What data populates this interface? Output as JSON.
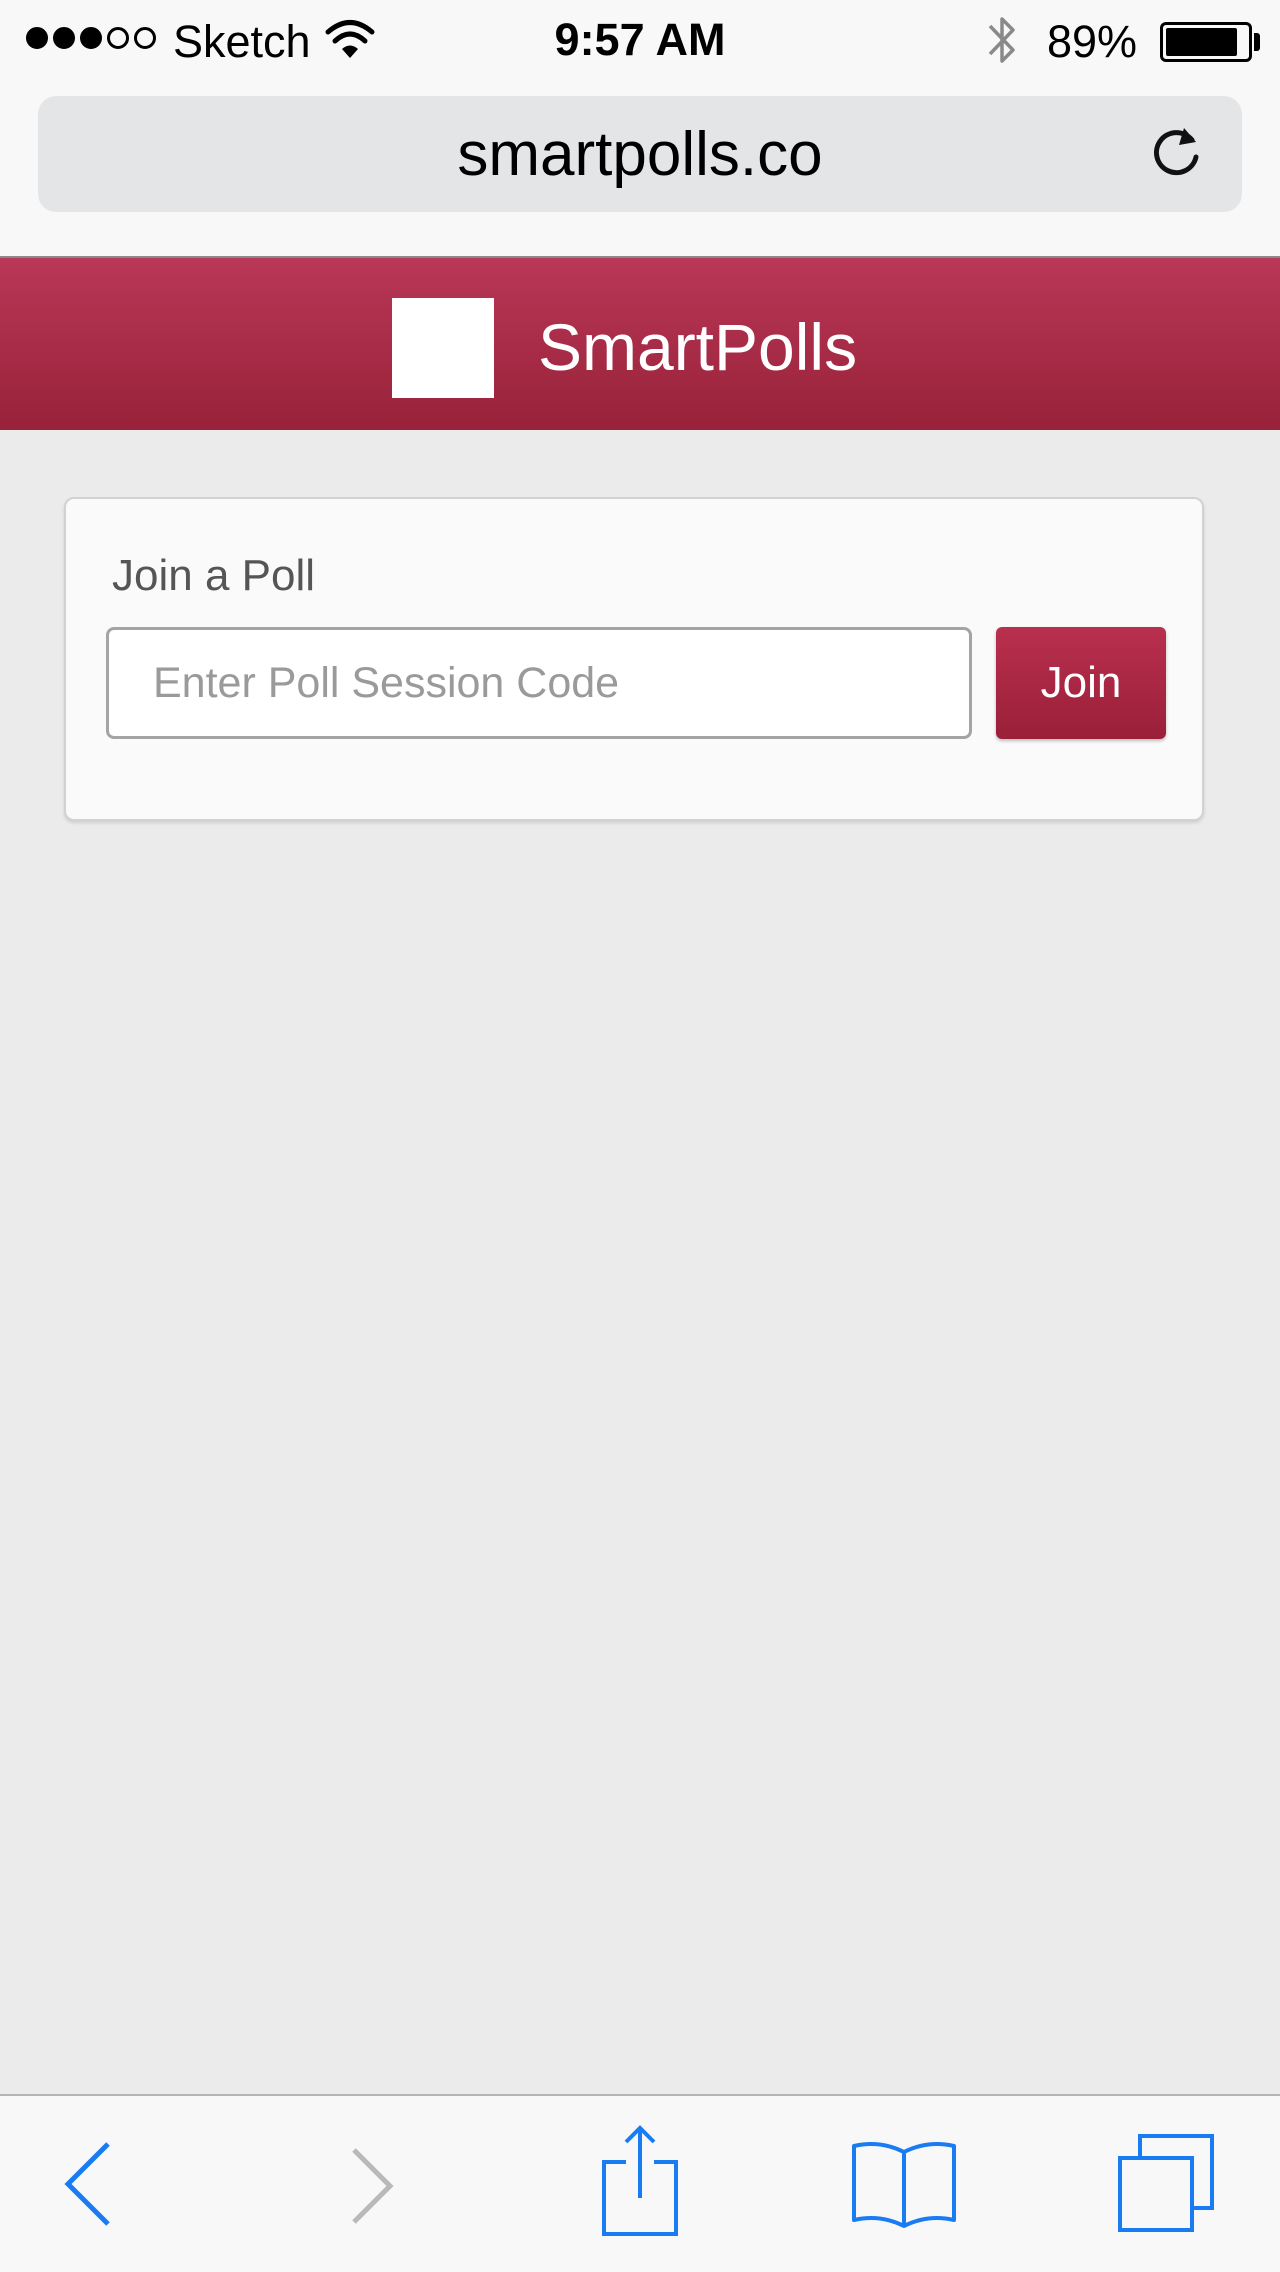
{
  "status_bar": {
    "signal_dots": [
      true,
      true,
      true,
      false,
      false
    ],
    "carrier": "Sketch",
    "time": "9:57 AM",
    "battery_percent": "89%",
    "battery_level": 0.89,
    "icons": [
      "wifi-icon",
      "bluetooth-icon",
      "battery-icon"
    ]
  },
  "browser": {
    "url": "smartpolls.co",
    "icons": [
      "reload-icon"
    ]
  },
  "header": {
    "app_name": "SmartPolls",
    "brand_color": "#a8294a",
    "logo": "logo-placeholder"
  },
  "join_card": {
    "title": "Join a Poll",
    "input_value": "",
    "input_placeholder": "Enter Poll Session Code",
    "button_label": "Join"
  },
  "toolbar": {
    "items": [
      {
        "icon": "back-icon",
        "enabled": true
      },
      {
        "icon": "forward-icon",
        "enabled": false
      },
      {
        "icon": "share-icon",
        "enabled": true
      },
      {
        "icon": "bookmarks-icon",
        "enabled": true
      },
      {
        "icon": "tabs-icon",
        "enabled": true
      }
    ],
    "accent_color": "#1a7cf2",
    "disabled_color": "#b9b9b9"
  }
}
